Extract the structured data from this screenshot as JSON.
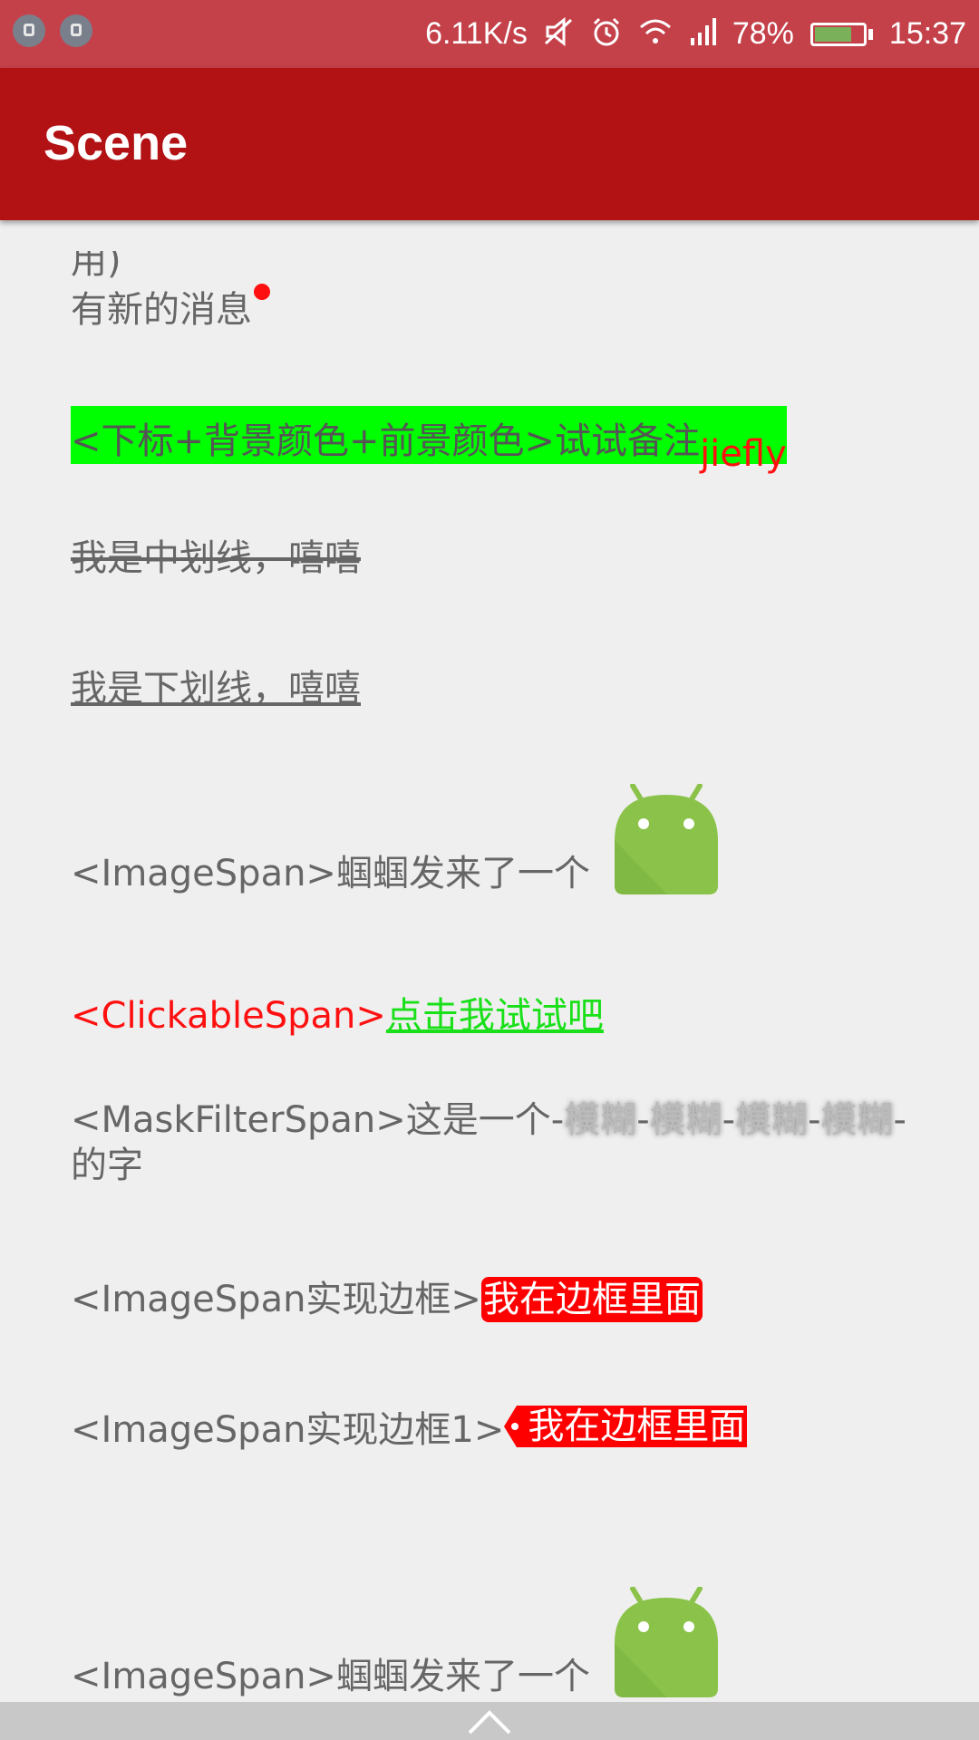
{
  "status_bar": {
    "speed": "6.11K/s",
    "battery": "78%",
    "battery_level": 0.78,
    "time": "15:37",
    "icons": [
      "notification-icon",
      "notification-icon",
      "mute-icon",
      "alarm-icon",
      "wifi-icon",
      "signal-icon",
      "battery-icon"
    ]
  },
  "app_bar": {
    "title": "Scene"
  },
  "content": {
    "partial_top": "用)",
    "new_message": "有新的消息",
    "subscript_line": {
      "main": "<下标+背景颜色+前景颜色>试试备注",
      "sub": "jiefly"
    },
    "strike_line": "我是中划线，嘻嘻",
    "underline_line": "我是下划线，嘻嘻",
    "imagespan_line": "<ImageSpan>蝈蝈发来了一个",
    "clickable_line": {
      "prefix": "<ClickableSpan>",
      "link": "点击我试试吧"
    },
    "mask_line": {
      "prefix": "<MaskFilterSpan>这是一个-",
      "blur1": "模糊",
      "sep1": "-",
      "blur2": "模糊",
      "sep2": "-",
      "blur3": "模糊",
      "sep3": "-",
      "blur4": "模糊",
      "sep4": "-",
      "line2": "的字"
    },
    "border_line": {
      "prefix": "<ImageSpan实现边框>",
      "boxed": "我在边框里面"
    },
    "border_line1": {
      "prefix": "<ImageSpan实现边框1>",
      "boxed": "我在边框里面"
    },
    "imagespan_line2": "<ImageSpan>蝈蝈发来了一个"
  },
  "colors": {
    "status_bar": "#c4414a",
    "app_bar": "#b31215",
    "android_green": "#8bc34a",
    "highlight_green": "#00ff00",
    "red": "#ff0000"
  }
}
